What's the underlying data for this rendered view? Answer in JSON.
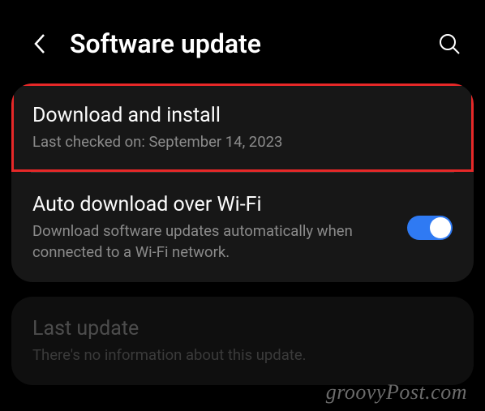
{
  "header": {
    "title": "Software update"
  },
  "sections": {
    "download_install": {
      "title": "Download and install",
      "subtitle": "Last checked on: September 14, 2023"
    },
    "auto_download": {
      "title": "Auto download over Wi-Fi",
      "subtitle": "Download software updates automatically when connected to a Wi-Fi network."
    },
    "last_update": {
      "title": "Last update",
      "subtitle": "There's no information about this update."
    }
  },
  "watermark": "groovyPost.com"
}
